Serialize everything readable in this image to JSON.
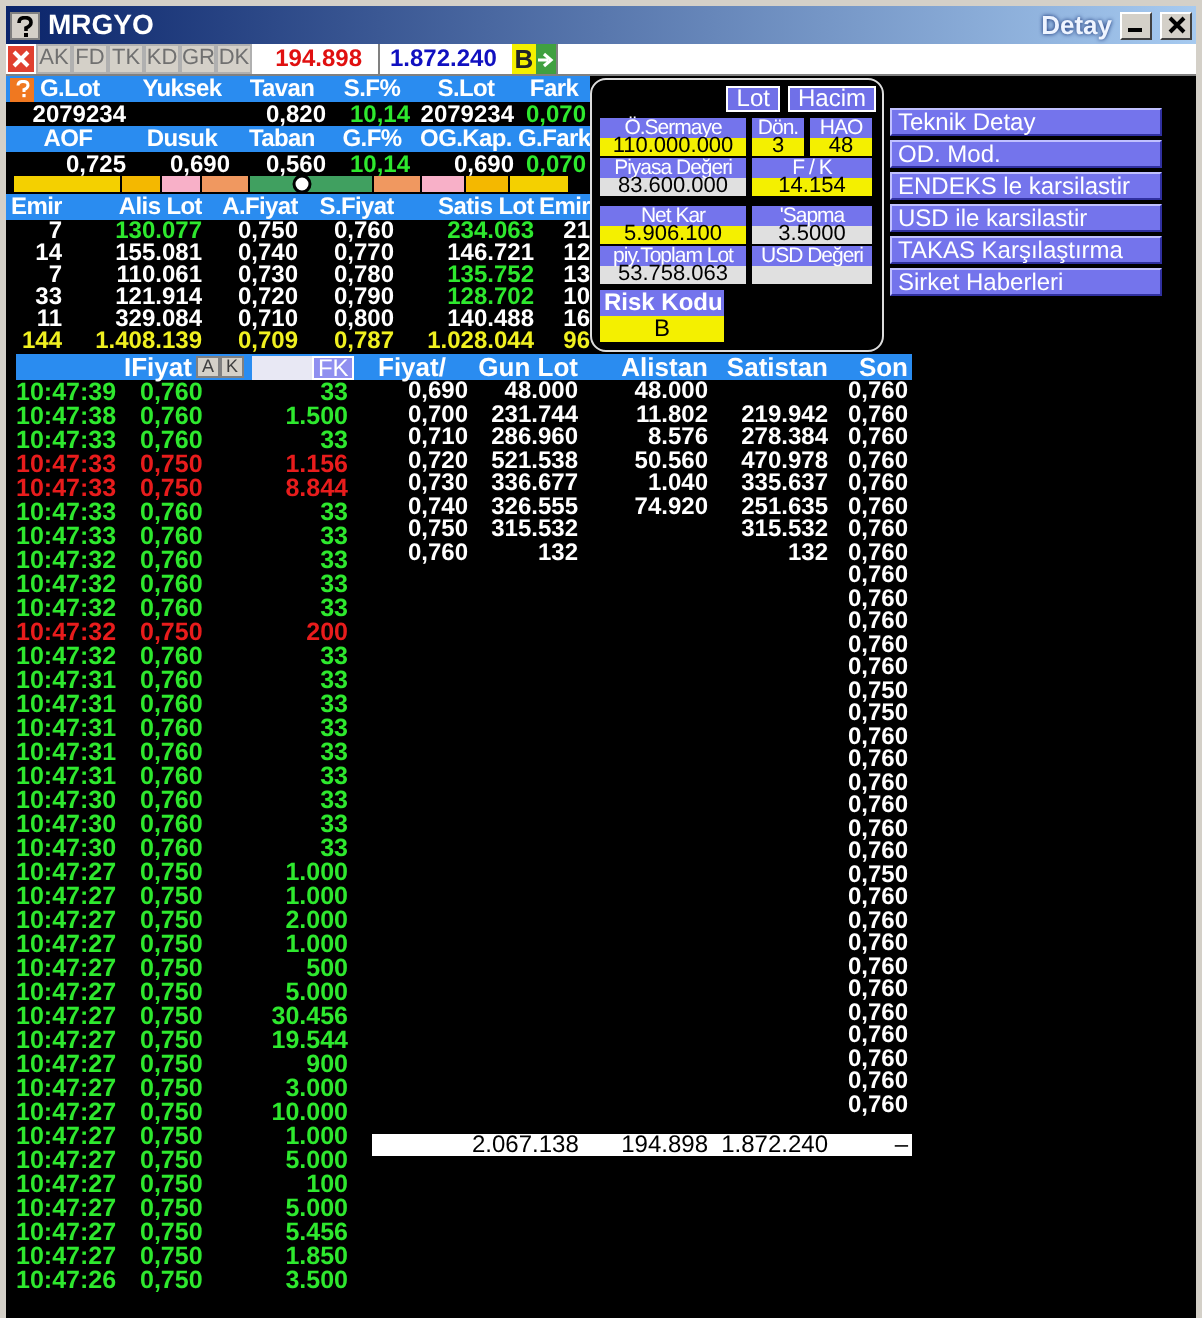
{
  "window": {
    "title": "MRGYO",
    "detail_title": "Detay"
  },
  "toolbar": {
    "tabs": [
      "AK",
      "FD",
      "TK",
      "KD",
      "GR",
      "DK"
    ],
    "value_sell": "194.898",
    "value_buy": "1.872.240",
    "badge": "B"
  },
  "summary": {
    "rows": [
      [
        {
          "header": "G.Lot",
          "value": "2079234",
          "up": false
        },
        {
          "header": "Yuksek"
        },
        {
          "header": "Tavan",
          "value": "0,820",
          "up": false
        },
        {
          "header": "S.F%",
          "value": "10,14",
          "up": true
        },
        {
          "header": "S.Lot",
          "value": "2079234",
          "up": false
        },
        {
          "header": "Fark",
          "value": "0,070",
          "up": true
        }
      ],
      [
        {
          "header": "AOF",
          "value": "0,725",
          "up": false
        },
        {
          "header": "Dusuk",
          "value": "0,690",
          "up": false
        },
        {
          "header": "Taban",
          "value": "0,560",
          "up": false
        },
        {
          "header": "G.F%",
          "value": "10,14",
          "up": true
        },
        {
          "header": "OG.Kap.",
          "value": "0,690",
          "up": false
        },
        {
          "header": "G.Fark",
          "value": "0,070",
          "up": true
        }
      ]
    ]
  },
  "order_book": {
    "columns": [
      "Emir",
      "Alis Lot",
      "A.Fiyat",
      "S.Fiyat",
      "Satis Lot",
      "Emir"
    ],
    "rows": [
      {
        "cells": [
          "7",
          "130.077",
          "0,750",
          "0,760",
          "234.063",
          "21"
        ],
        "bid_up": true,
        "ask_up": true
      },
      {
        "cells": [
          "14",
          "155.081",
          "0,740",
          "0,770",
          "146.721",
          "12"
        ],
        "bid_up": false,
        "ask_up": false
      },
      {
        "cells": [
          "7",
          "110.061",
          "0,730",
          "0,780",
          "135.752",
          "13"
        ],
        "bid_up": false,
        "ask_up": true
      },
      {
        "cells": [
          "33",
          "121.914",
          "0,720",
          "0,790",
          "128.702",
          "10"
        ],
        "bid_up": false,
        "ask_up": true
      },
      {
        "cells": [
          "11",
          "329.084",
          "0,710",
          "0,800",
          "140.488",
          "16"
        ],
        "bid_up": false,
        "ask_up": false
      }
    ],
    "totals": [
      "144",
      "1.408.139",
      "0,709",
      "0,787",
      "1.028.044",
      "96"
    ]
  },
  "detail_panel": {
    "toggles": [
      "Lot",
      "Hacim"
    ],
    "fields": [
      {
        "label": "Ö.Sermaye",
        "value": "110.000.000",
        "highlighted": true
      },
      {
        "label": "Dön.",
        "value": "3",
        "highlighted": true
      },
      {
        "label": "HAO",
        "value": "48",
        "highlighted": true
      },
      {
        "label": "Piyasa Değeri",
        "value": "83.600.000",
        "highlighted": false
      },
      {
        "label": "F / K",
        "value": "14.154",
        "highlighted": true
      },
      {
        "label": "Net Kar",
        "value": "5.906.100",
        "highlighted": true
      },
      {
        "label": "'Sapma",
        "value": "3.5000",
        "highlighted": false
      },
      {
        "label": "piy.Toplam Lot",
        "value": "53.758.063",
        "highlighted": false
      },
      {
        "label": "USD Değeri",
        "highlighted": false
      }
    ],
    "risk": {
      "label": "Risk Kodu",
      "value": "B"
    }
  },
  "menu": [
    "Teknik Detay",
    "OD. Mod.",
    "ENDEKS le karsilastir",
    "USD ile karsilastir",
    "TAKAS Karşılaştırma",
    "Sirket Haberleri"
  ],
  "trades": {
    "header": "IFiyat",
    "buttons": [
      "A",
      "K",
      "FK"
    ],
    "rows": [
      {
        "time": "10:47:39",
        "price": "0,760",
        "lot": "33",
        "sell": false
      },
      {
        "time": "10:47:38",
        "price": "0,760",
        "lot": "1.500",
        "sell": false
      },
      {
        "time": "10:47:33",
        "price": "0,760",
        "lot": "33",
        "sell": false
      },
      {
        "time": "10:47:33",
        "price": "0,750",
        "lot": "1.156",
        "sell": true
      },
      {
        "time": "10:47:33",
        "price": "0,750",
        "lot": "8.844",
        "sell": true
      },
      {
        "time": "10:47:33",
        "price": "0,760",
        "lot": "33",
        "sell": false
      },
      {
        "time": "10:47:33",
        "price": "0,760",
        "lot": "33",
        "sell": false
      },
      {
        "time": "10:47:32",
        "price": "0,760",
        "lot": "33",
        "sell": false
      },
      {
        "time": "10:47:32",
        "price": "0,760",
        "lot": "33",
        "sell": false
      },
      {
        "time": "10:47:32",
        "price": "0,760",
        "lot": "33",
        "sell": false
      },
      {
        "time": "10:47:32",
        "price": "0,750",
        "lot": "200",
        "sell": true
      },
      {
        "time": "10:47:32",
        "price": "0,760",
        "lot": "33",
        "sell": false
      },
      {
        "time": "10:47:31",
        "price": "0,760",
        "lot": "33",
        "sell": false
      },
      {
        "time": "10:47:31",
        "price": "0,760",
        "lot": "33",
        "sell": false
      },
      {
        "time": "10:47:31",
        "price": "0,760",
        "lot": "33",
        "sell": false
      },
      {
        "time": "10:47:31",
        "price": "0,760",
        "lot": "33",
        "sell": false
      },
      {
        "time": "10:47:31",
        "price": "0,760",
        "lot": "33",
        "sell": false
      },
      {
        "time": "10:47:30",
        "price": "0,760",
        "lot": "33",
        "sell": false
      },
      {
        "time": "10:47:30",
        "price": "0,760",
        "lot": "33",
        "sell": false
      },
      {
        "time": "10:47:30",
        "price": "0,760",
        "lot": "33",
        "sell": false
      },
      {
        "time": "10:47:27",
        "price": "0,750",
        "lot": "1.000",
        "sell": false
      },
      {
        "time": "10:47:27",
        "price": "0,750",
        "lot": "1.000",
        "sell": false
      },
      {
        "time": "10:47:27",
        "price": "0,750",
        "lot": "2.000",
        "sell": false
      },
      {
        "time": "10:47:27",
        "price": "0,750",
        "lot": "1.000",
        "sell": false
      },
      {
        "time": "10:47:27",
        "price": "0,750",
        "lot": "500",
        "sell": false
      },
      {
        "time": "10:47:27",
        "price": "0,750",
        "lot": "5.000",
        "sell": false
      },
      {
        "time": "10:47:27",
        "price": "0,750",
        "lot": "30.456",
        "sell": false
      },
      {
        "time": "10:47:27",
        "price": "0,750",
        "lot": "19.544",
        "sell": false
      },
      {
        "time": "10:47:27",
        "price": "0,750",
        "lot": "900",
        "sell": false
      },
      {
        "time": "10:47:27",
        "price": "0,750",
        "lot": "3.000",
        "sell": false
      },
      {
        "time": "10:47:27",
        "price": "0,750",
        "lot": "10.000",
        "sell": false
      },
      {
        "time": "10:47:27",
        "price": "0,750",
        "lot": "1.000",
        "sell": false
      },
      {
        "time": "10:47:27",
        "price": "0,750",
        "lot": "5.000",
        "sell": false
      },
      {
        "time": "10:47:27",
        "price": "0,750",
        "lot": "100",
        "sell": false
      },
      {
        "time": "10:47:27",
        "price": "0,750",
        "lot": "5.000",
        "sell": false
      },
      {
        "time": "10:47:27",
        "price": "0,750",
        "lot": "5.456",
        "sell": false
      },
      {
        "time": "10:47:27",
        "price": "0,750",
        "lot": "1.850",
        "sell": false
      },
      {
        "time": "10:47:26",
        "price": "0,750",
        "lot": "3.500",
        "sell": false
      }
    ]
  },
  "price_table": {
    "columns": [
      "Fiyat/",
      "Gun Lot",
      "Alistan",
      "Satistan",
      "Son"
    ],
    "rows": [
      {
        "price": "0,690",
        "day_lot": "48.000",
        "bid": "48.000"
      },
      {
        "price": "0,700",
        "day_lot": "231.744",
        "bid": "11.802",
        "ask": "219.942"
      },
      {
        "price": "0,710",
        "day_lot": "286.960",
        "bid": "8.576",
        "ask": "278.384"
      },
      {
        "price": "0,720",
        "day_lot": "521.538",
        "bid": "50.560",
        "ask": "470.978"
      },
      {
        "price": "0,730",
        "day_lot": "336.677",
        "bid": "1.040",
        "ask": "335.637"
      },
      {
        "price": "0,740",
        "day_lot": "326.555",
        "bid": "74.920",
        "ask": "251.635"
      },
      {
        "price": "0,750",
        "day_lot": "315.532",
        "ask": "315.532"
      },
      {
        "price": "0,760",
        "day_lot": "132",
        "ask": "132"
      }
    ],
    "last_prices": [
      "0,760",
      "0,760",
      "0,760",
      "0,760",
      "0,760",
      "0,760",
      "0,760",
      "0,760",
      "0,760",
      "0,760",
      "0,760",
      "0,760",
      "0,760",
      "0,750",
      "0,750",
      "0,760",
      "0,760",
      "0,760",
      "0,760",
      "0,760",
      "0,760",
      "0,750",
      "0,760",
      "0,760",
      "0,760",
      "0,760",
      "0,760",
      "0,760",
      "0,760",
      "0,760",
      "0,760",
      "0,760"
    ],
    "totals": {
      "day_lot": "2.067.138",
      "bid": "194.898",
      "ask": "1.872.240",
      "last": "–"
    }
  }
}
